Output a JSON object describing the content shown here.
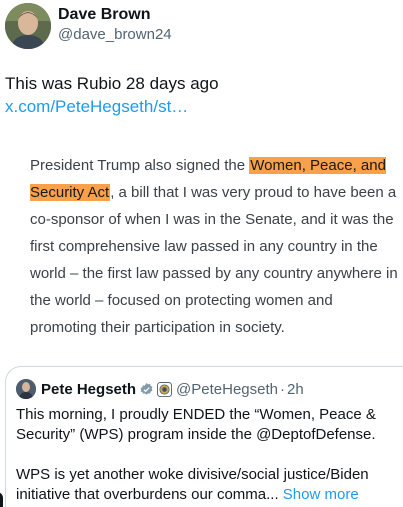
{
  "author": {
    "display_name": "Dave Brown",
    "handle": "@dave_brown24"
  },
  "tweet": {
    "text": "This was Rubio 28 days ago ",
    "link_text": "x.com/PeteHegseth/st…"
  },
  "image_quote": {
    "before": "President Trump also signed the ",
    "highlight": "Women, Peace, and Security Act",
    "after": ", a bill that I was very proud to have been a co-sponsor of when I was in the Senate, and it was the first comprehensive law passed in any country in the world – the first law passed by any country anywhere in the world – focused on protecting women and promoting their participation in society.",
    "highlight_color": "#f8a14a"
  },
  "quoted_tweet": {
    "display_name": "Pete Hegseth",
    "handle": "@PeteHegseth",
    "separator": "·",
    "time": "2h",
    "paragraph1": "This morning, I proudly ENDED the “Women, Peace & Security” (WPS) program inside the @DeptofDefense.",
    "paragraph2": "WPS is yet another woke divisive/social justice/Biden initiative that overburdens our comma... ",
    "show_more": "Show more"
  },
  "colors": {
    "link": "#1d9bf0",
    "secondary_text": "#536471",
    "verified_badge": "#1d9bf0"
  }
}
